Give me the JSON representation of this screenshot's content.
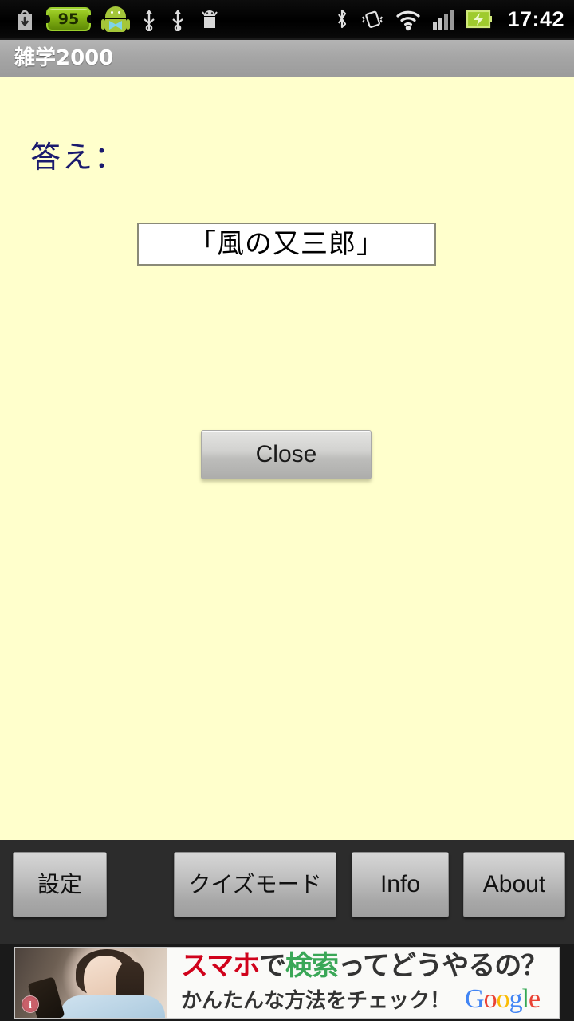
{
  "statusbar": {
    "time": "17:42",
    "battery_percent": "95",
    "icons": [
      "download-icon",
      "battery-95-badge",
      "android-mascot-icon",
      "usb-icon",
      "usb-icon",
      "android-debug-icon",
      "bluetooth-icon",
      "vibrate-icon",
      "wifi-icon",
      "signal-icon",
      "battery-charging-icon"
    ]
  },
  "titlebar": {
    "title": "雑学2000"
  },
  "content": {
    "answer_label": "答え：",
    "answer_text": "「風の又三郎」",
    "close_label": "Close",
    "background_color": "#ffffcc",
    "label_color": "#1a1a6e"
  },
  "toolbar": {
    "settings_label": "設定",
    "quiz_label": "クイズモード",
    "info_label": "Info",
    "about_label": "About",
    "background_color": "#2c2c2c"
  },
  "ad": {
    "headline_part1": "スマホ",
    "headline_part2": "で",
    "headline_part3": "検索",
    "headline_part4": "ってどうやるの？",
    "subline": "かんたんな方法をチェック！",
    "brand_g": "G",
    "brand_o1": "o",
    "brand_o2": "o",
    "brand_g2": "g",
    "brand_l": "l",
    "brand_e": "e",
    "adchoices_label": "i"
  }
}
